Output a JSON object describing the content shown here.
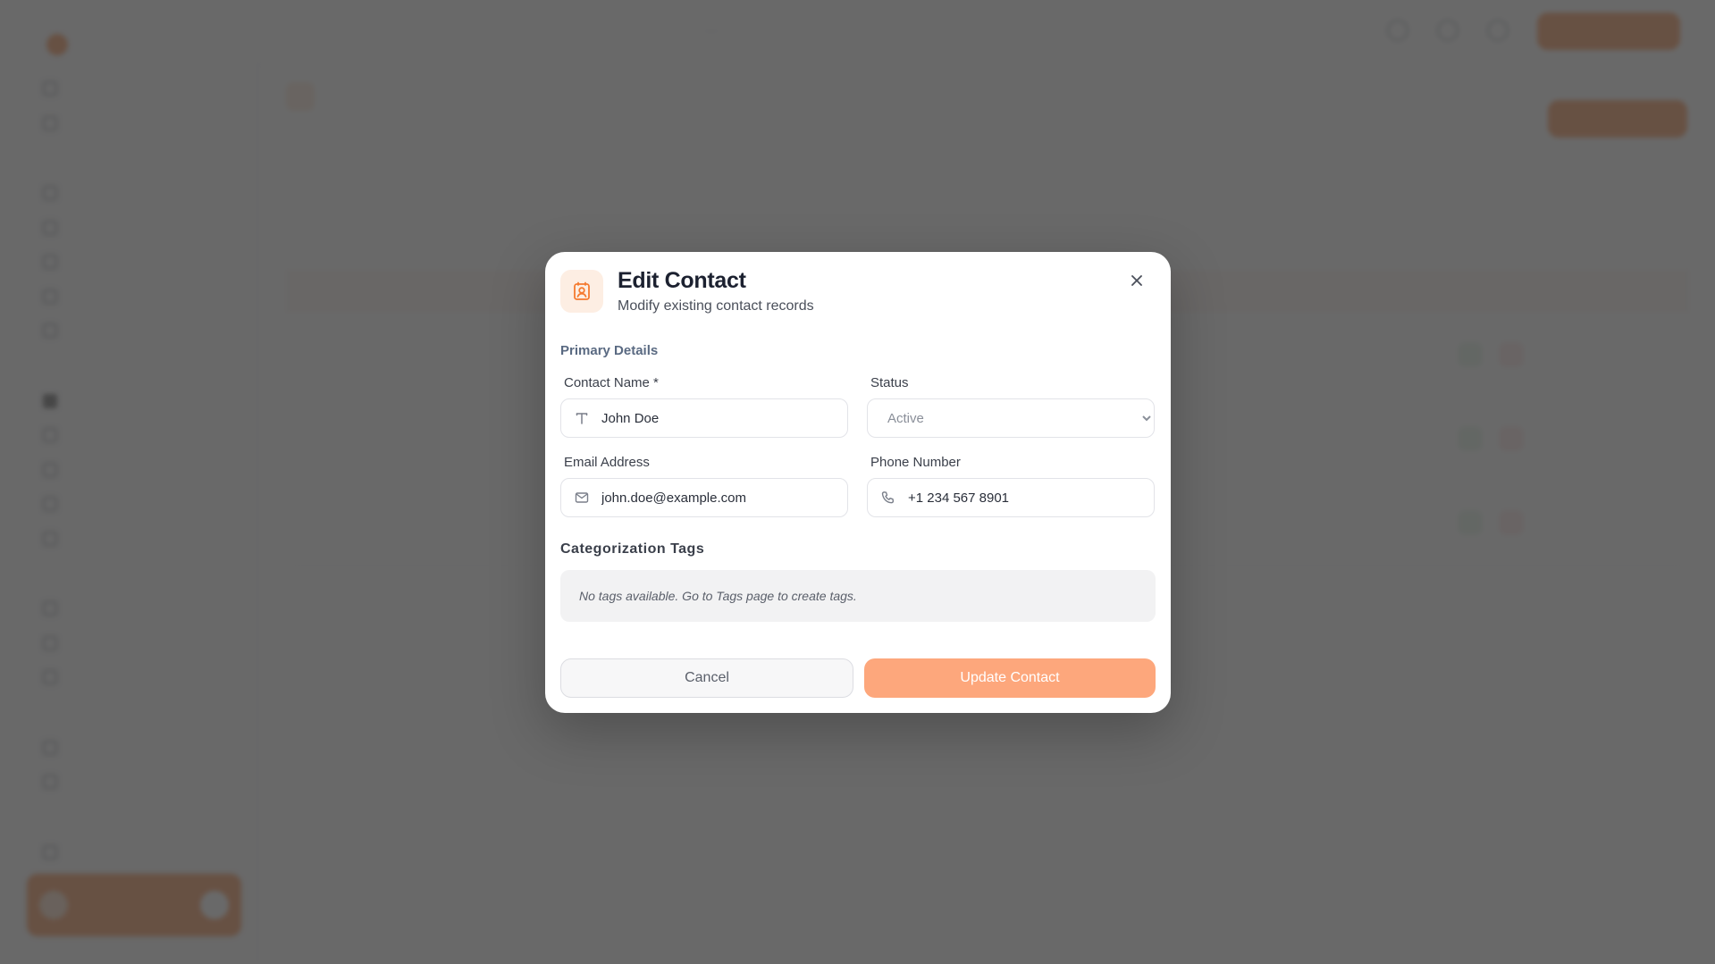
{
  "modal": {
    "title": "Edit Contact",
    "subtitle": "Modify existing contact records",
    "icon": "contact-card-icon",
    "close_icon": "close-icon",
    "section_label": "Primary Details",
    "fields": {
      "contact_name": {
        "label": "Contact Name *",
        "value": "John Doe",
        "icon": "text-type-icon"
      },
      "status": {
        "label": "Status",
        "selected": "Active",
        "options": [
          "Active"
        ]
      },
      "email": {
        "label": "Email Address",
        "value": "john.doe@example.com",
        "icon": "mail-icon"
      },
      "phone": {
        "label": "Phone Number",
        "value": "+1 234 567 8901",
        "icon": "phone-icon"
      }
    },
    "tags": {
      "title": "Categorization Tags",
      "empty_message": "No tags available. Go to Tags page to create tags."
    },
    "buttons": {
      "cancel": "Cancel",
      "update": "Update Contact"
    }
  },
  "colors": {
    "accent": "#f57a2f",
    "accent_light": "#fda77c",
    "overlay": "#484848",
    "section_label": "#5a6a82"
  }
}
